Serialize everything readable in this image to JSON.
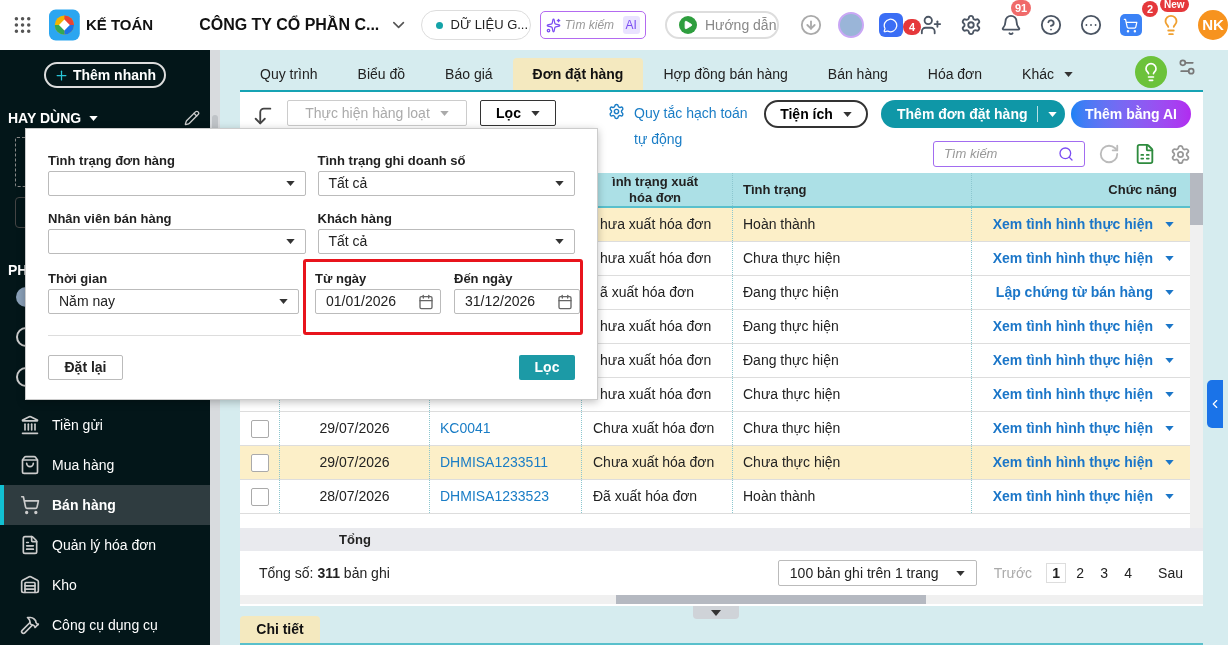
{
  "top_bar": {
    "app_name": "KẾ TOÁN",
    "company": "CÔNG TY CỔ PHẦN C...",
    "data_source": "DỮ LIỆU G...",
    "search_placeholder": "Tìm kiếm",
    "ai_badge": "AI",
    "guide_button": "Hướng dẫn",
    "chat_badge": "4",
    "notification_badge": "91",
    "cart_badge": "2",
    "new_badge": "New",
    "user_initials": "NK"
  },
  "sidebar": {
    "quick_add": "Thêm nhanh",
    "favorites_title": "HAY DÙNG",
    "section_label": "PH",
    "items": [
      {
        "label": "Tiền gửi",
        "selected": false
      },
      {
        "label": "Mua hàng",
        "selected": false
      },
      {
        "label": "Bán hàng",
        "selected": true
      },
      {
        "label": "Quản lý hóa đơn",
        "selected": false
      },
      {
        "label": "Kho",
        "selected": false
      },
      {
        "label": "Công cụ dụng cụ",
        "selected": false
      }
    ]
  },
  "tabs": [
    {
      "label": "Quy trình",
      "selected": false,
      "dropdown": false
    },
    {
      "label": "Biểu đồ",
      "selected": false,
      "dropdown": false
    },
    {
      "label": "Báo giá",
      "selected": false,
      "dropdown": false
    },
    {
      "label": "Đơn đặt hàng",
      "selected": true,
      "dropdown": false
    },
    {
      "label": "Hợp đồng bán hàng",
      "selected": false,
      "dropdown": false
    },
    {
      "label": "Bán hàng",
      "selected": false,
      "dropdown": false
    },
    {
      "label": "Hóa đơn",
      "selected": false,
      "dropdown": false
    },
    {
      "label": "Khác",
      "selected": false,
      "dropdown": true
    }
  ],
  "toolbar": {
    "bulk_action": "Thực hiện hàng loạt",
    "bulk_disabled": true,
    "filter": "Lọc",
    "accounting_rule_link": "Quy tắc hạch toán tự động",
    "utilities": "Tiện ích",
    "add_order": "Thêm đơn đặt hàng",
    "add_ai": "Thêm bằng AI",
    "search_placeholder": "Tìm kiếm"
  },
  "filter_panel": {
    "fields": [
      {
        "label": "Tình trạng đơn hàng"
      },
      {
        "label": "Tình trạng ghi doanh số",
        "value": "Tất cả"
      },
      {
        "label": "Nhân viên bán hàng"
      },
      {
        "label": "Khách hàng",
        "value": "Tất cả"
      },
      {
        "label": "Thời gian",
        "value": "Năm nay"
      }
    ],
    "date_range_highlighted": true,
    "date_from": {
      "label": "Từ ngày",
      "value": "01/01/2026"
    },
    "date_to": {
      "label": "Đến ngày",
      "value": "31/12/2026"
    },
    "reset_button": "Đặt lại",
    "apply_button": "Lọc"
  },
  "table": {
    "columns": [
      "ình trạng xuất hóa đơn",
      "Tình trạng",
      "Chức năng"
    ],
    "rows": [
      {
        "invoice_status": "hưa xuất hóa đơn",
        "status": "Hoàn thành",
        "action": "Xem tình hình thực hiện",
        "selected": true
      },
      {
        "invoice_status": "hưa xuất hóa đơn",
        "status": "Chưa thực hiện",
        "action": "Xem tình hình thực hiện",
        "selected": false
      },
      {
        "invoice_status": "ã xuất hóa đơn",
        "status": "Đang thực hiện",
        "action": "Lập chứng từ bán hàng",
        "selected": false
      },
      {
        "invoice_status": "hưa xuất hóa đơn",
        "status": "Đang thực hiện",
        "action": "Xem tình hình thực hiện",
        "selected": false
      },
      {
        "invoice_status": "hưa xuất hóa đơn",
        "status": "Đang thực hiện",
        "action": "Xem tình hình thực hiện",
        "selected": false
      },
      {
        "invoice_status": "hưa xuất hóa đơn",
        "status": "Chưa thực hiện",
        "action": "Xem tình hình thực hiện",
        "selected": false
      },
      {
        "checked": false,
        "date": "29/07/2026",
        "code": "KC0041",
        "invoice_status": "Chưa xuất hóa đơn",
        "status": "Chưa thực hiện",
        "action": "Xem tình hình thực hiện",
        "selected": false
      },
      {
        "checked": false,
        "date": "29/07/2026",
        "code": "DHMISA1233511",
        "invoice_status": "Chưa xuất hóa đơn",
        "status": "Chưa thực hiện",
        "action": "Xem tình hình thực hiện",
        "selected": true
      },
      {
        "checked": false,
        "date": "28/07/2026",
        "code": "DHMISA1233523",
        "invoice_status": "Đã xuất hóa đơn",
        "status": "Hoàn thành",
        "action": "Xem tình hình thực hiện",
        "selected": false
      }
    ],
    "summary_label": "Tổng"
  },
  "footer": {
    "total_records": "Tổng số: **311** bản ghi",
    "page_size": "100 bản ghi trên 1 trang",
    "prev": "Trước",
    "prev_disabled": true,
    "pages": [
      {
        "label": "1",
        "selected": true
      },
      {
        "label": "2",
        "selected": false
      },
      {
        "label": "3",
        "selected": false
      },
      {
        "label": "4",
        "selected": false
      }
    ],
    "next": "Sau"
  },
  "detail_tab": "Chi tiết"
}
